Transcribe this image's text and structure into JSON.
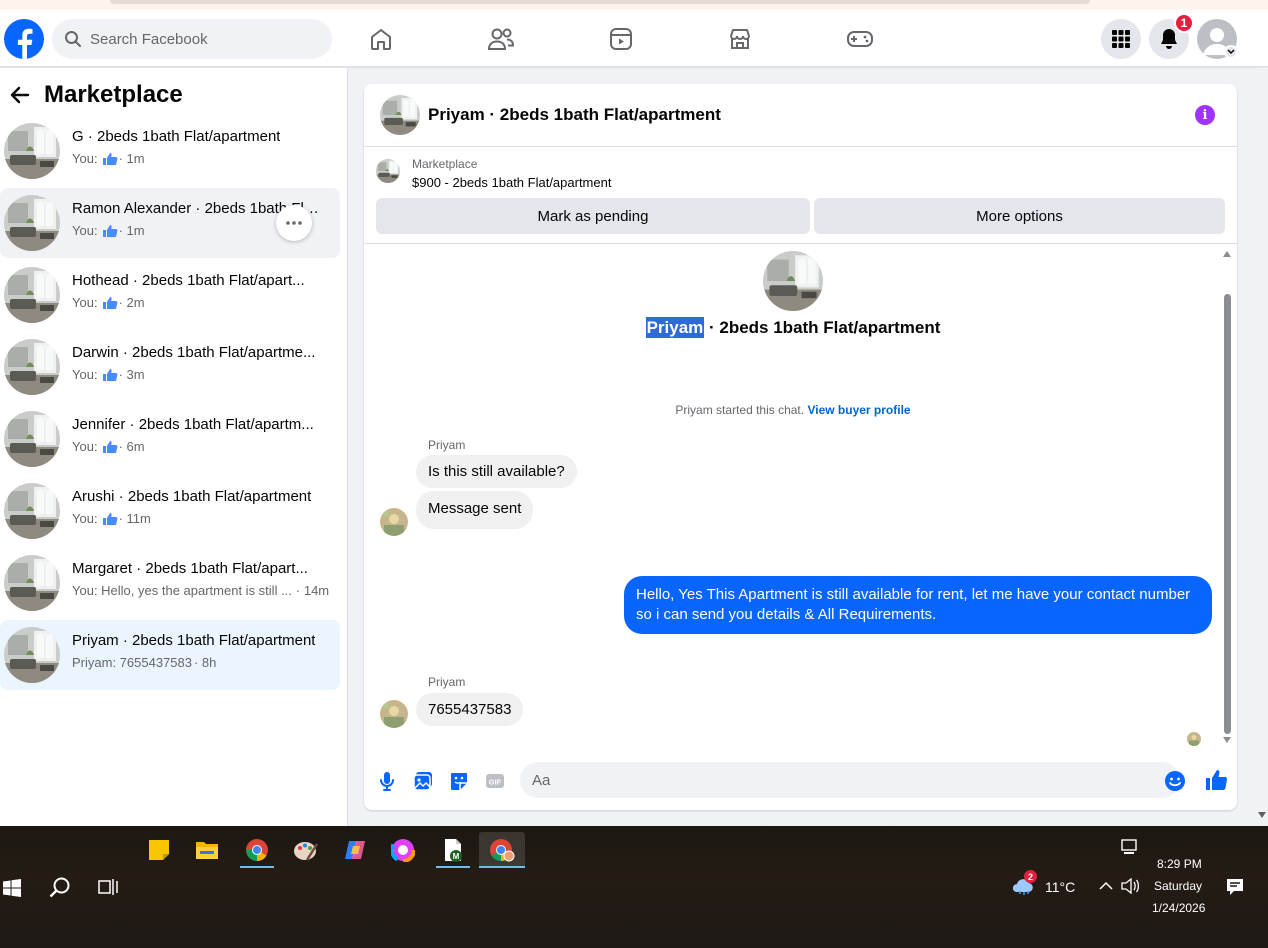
{
  "header": {
    "search_placeholder": "Search Facebook",
    "notification_count": "1"
  },
  "sidebar": {
    "title": "Marketplace",
    "conversations": [
      {
        "name": "G · 2beds 1bath Flat/apartment",
        "sub_prefix": "You:",
        "liked": true,
        "time": "· 1m"
      },
      {
        "name": "Ramon Alexander · 2beds 1bath Fla...",
        "sub_prefix": "You:",
        "liked": true,
        "time": "· 1m"
      },
      {
        "name": "Hothead · 2beds 1bath Flat/apart...",
        "sub_prefix": "You:",
        "liked": true,
        "time": "· 2m"
      },
      {
        "name": "Darwin · 2beds 1bath Flat/apartme...",
        "sub_prefix": "You:",
        "liked": true,
        "time": "· 3m"
      },
      {
        "name": "Jennifer · 2beds 1bath Flat/apartm...",
        "sub_prefix": "You:",
        "liked": true,
        "time": "· 6m"
      },
      {
        "name": "Arushi · 2beds 1bath Flat/apartment",
        "sub_prefix": "You:",
        "liked": true,
        "time": "· 11m"
      },
      {
        "name": "Margaret · 2beds 1bath Flat/apart...",
        "sub_prefix": "You: Hello, yes the apartment is still ...",
        "liked": false,
        "time": "· 14m"
      },
      {
        "name": "Priyam · 2beds 1bath Flat/apartment",
        "sub_prefix": "Priyam: 7655437583",
        "liked": false,
        "time": "· 8h"
      }
    ]
  },
  "chat": {
    "title": "Priyam · 2beds 1bath Flat/apartment",
    "listing_source": "Marketplace",
    "listing_price": "$900 - 2beds 1bath Flat/apartment",
    "mark_pending_label": "Mark as pending",
    "more_options_label": "More options",
    "intro_name": "Priyam",
    "intro_rest": " · 2beds 1bath Flat/apartment",
    "started_text": "Priyam started this chat.",
    "view_buyer_label": "View buyer profile",
    "messages": [
      {
        "sender": "Priyam",
        "text": "Is this still available?"
      },
      {
        "text": "Message sent"
      },
      {
        "text": "Hello, Yes This Apartment is still available for rent, let me have your contact number so i can send you details & All Requirements."
      },
      {
        "sender": "Priyam",
        "text": "7655437583"
      }
    ],
    "composer_placeholder": "Aa"
  },
  "taskbar": {
    "weather": "11°C",
    "weather_badge": "2",
    "time": "8:29 PM",
    "day": "Saturday",
    "date": "1/24/2026"
  },
  "colors": {
    "fb_blue": "#0866ff",
    "link_blue": "#0064d1",
    "info_purple": "#a033ff",
    "badge_red": "#e41e3f"
  }
}
